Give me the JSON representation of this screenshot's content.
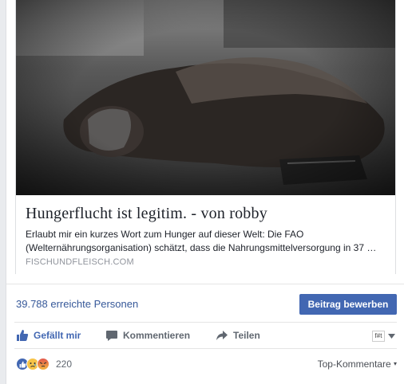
{
  "link": {
    "title": "Hungerflucht ist legitim. - von robby",
    "description": "Erlaubt mir ein kurzes Wort zum Hunger auf dieser Welt: Die FAO (Welternährungsorganisation) schätzt, dass die Nahrungsmittelversorgung in 37 …",
    "source": "FISCHUNDFLEISCH.COM"
  },
  "reach": {
    "text": "39.788 erreichte Personen",
    "boost_label": "Beitrag bewerben"
  },
  "actions": {
    "like": "Gefällt mir",
    "comment": "Kommentieren",
    "share": "Teilen"
  },
  "page_switcher": {
    "avatar_text": "f#t"
  },
  "reactions": {
    "icons": [
      "like-icon",
      "sad-icon",
      "angry-icon"
    ],
    "count": "220",
    "sort_label": "Top-Kommentare"
  },
  "colors": {
    "link_blue": "#365899",
    "button_blue": "#4267b2",
    "muted": "#606770"
  }
}
